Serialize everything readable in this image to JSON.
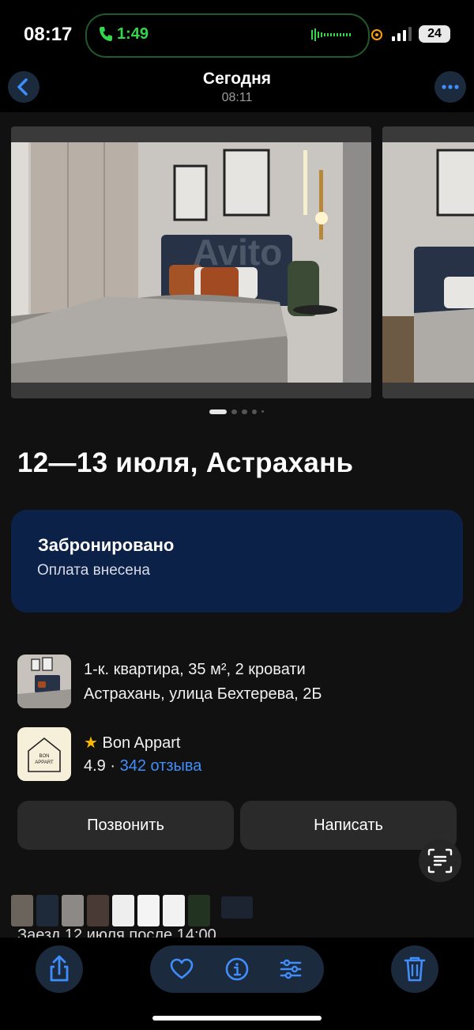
{
  "status_bar": {
    "time": "08:17",
    "call_time": "1:49",
    "battery": "24",
    "accent_green": "#32d74b"
  },
  "nav": {
    "title": "Сегодня",
    "subtitle": "08:11"
  },
  "gallery": {
    "photo_count": 5,
    "active_index": 0,
    "watermark": "Avito"
  },
  "listing": {
    "title": "12—13 июля, Астрахань",
    "status_title": "Забронировано",
    "status_sub": "Оплата внесена",
    "apartment_line1": "1-к. квартира, 35 м², 2 кровати",
    "apartment_line2": "Астрахань, улица Бехтерева, 2Б"
  },
  "host": {
    "name": "Bon Appart",
    "rating": "4.9",
    "separator": " · ",
    "reviews": "342 отзыва",
    "logo_text_1": "BON",
    "logo_text_2": "APPART"
  },
  "actions": {
    "call_label": "Позвонить",
    "write_label": "Написать"
  },
  "checkin_hint": "Заезд 12 июля после 14:00",
  "colors": {
    "background": "#111111",
    "booking_card": "#0c2148",
    "link_blue": "#3f8efc",
    "icon_blue": "#3f8efc",
    "button_bg": "#2a2a2a"
  }
}
